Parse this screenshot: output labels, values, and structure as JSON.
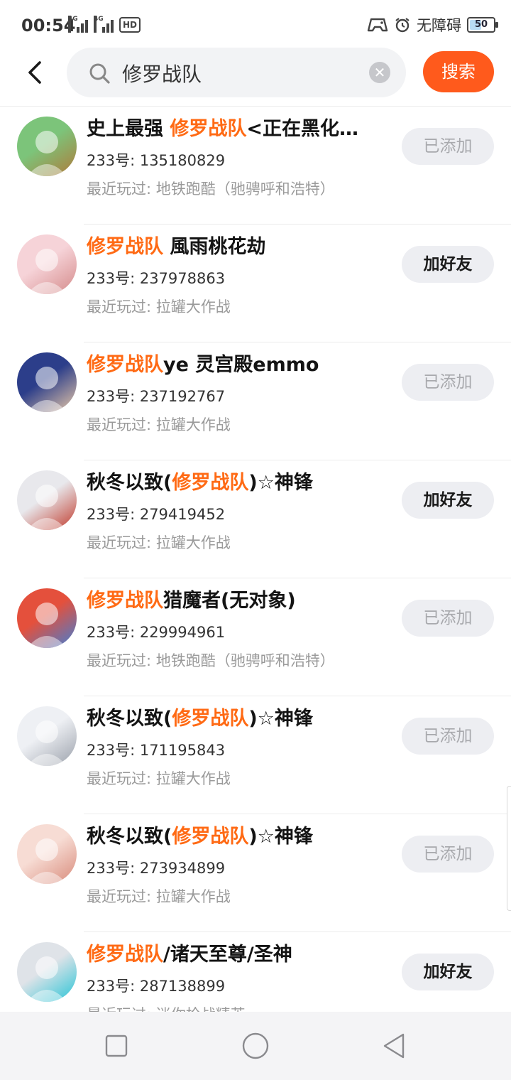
{
  "status_bar": {
    "time": "00:54",
    "network_labels": [
      "4G",
      "4G"
    ],
    "hd_label": "HD",
    "accessibility_label": "无障碍",
    "battery_level": "50",
    "icons": [
      "signal-icon",
      "signal-icon",
      "hd-icon",
      "gamepad-icon",
      "alarm-icon",
      "battery-icon"
    ]
  },
  "search": {
    "query": "修罗战队",
    "button_label": "搜索",
    "icons": [
      "back-arrow-icon",
      "search-icon",
      "clear-icon"
    ]
  },
  "results": [
    {
      "name_parts": [
        {
          "text": "史上最强 ",
          "hl": false
        },
        {
          "text": "修罗战队",
          "hl": true
        },
        {
          "text": "<正在黑化…",
          "hl": false
        }
      ],
      "uid": "233号: 135180829",
      "recent": "最近玩过: 地铁跑酷（驰骋呼和浩特）",
      "action": "已添加",
      "added": true,
      "avatar": "avatar-bear-watermelon",
      "colors": [
        "#7cc47a",
        "#b07a3a"
      ]
    },
    {
      "name_parts": [
        {
          "text": "修罗战队",
          "hl": true
        },
        {
          "text": " 風雨桃花劫",
          "hl": false
        }
      ],
      "uid": "233号: 237978863",
      "recent": "最近玩过: 拉罐大作战",
      "action": "加好友",
      "added": false,
      "avatar": "avatar-anime-girl",
      "colors": [
        "#f6d3d8",
        "#d48a8a"
      ]
    },
    {
      "name_parts": [
        {
          "text": "修罗战队",
          "hl": true
        },
        {
          "text": "ye  灵宫殿emmo",
          "hl": false
        }
      ],
      "uid": "233号: 237192767",
      "recent": "最近玩过: 拉罐大作战",
      "action": "已添加",
      "added": true,
      "avatar": "avatar-anime-detective",
      "colors": [
        "#2c3e8a",
        "#e9c9a8"
      ]
    },
    {
      "name_parts": [
        {
          "text": "秋冬以致(",
          "hl": false
        },
        {
          "text": "修罗战队",
          "hl": true
        },
        {
          "text": ")☆神锋",
          "hl": false
        }
      ],
      "uid": "233号: 279419452",
      "recent": "最近玩过: 拉罐大作战",
      "action": "加好友",
      "added": false,
      "avatar": "avatar-anime-boy-redwhite",
      "colors": [
        "#e8e8ec",
        "#c0392b"
      ]
    },
    {
      "name_parts": [
        {
          "text": "修罗战队",
          "hl": true
        },
        {
          "text": "猎魔者(无对象)",
          "hl": false
        }
      ],
      "uid": "233号: 229994961",
      "recent": "最近玩过: 地铁跑酷（驰骋呼和浩特）",
      "action": "已添加",
      "added": true,
      "avatar": "avatar-photo-boy",
      "colors": [
        "#e4503c",
        "#3f7fd6"
      ]
    },
    {
      "name_parts": [
        {
          "text": "秋冬以致(",
          "hl": false
        },
        {
          "text": "修罗战队",
          "hl": true
        },
        {
          "text": ")☆神锋",
          "hl": false
        }
      ],
      "uid": "233号: 171195843",
      "recent": "最近玩过: 拉罐大作战",
      "action": "已添加",
      "added": true,
      "avatar": "avatar-anime-boy-silver",
      "colors": [
        "#eef0f4",
        "#9aa0aa"
      ]
    },
    {
      "name_parts": [
        {
          "text": "秋冬以致(",
          "hl": false
        },
        {
          "text": "修罗战队",
          "hl": true
        },
        {
          "text": ")☆神锋",
          "hl": false
        }
      ],
      "uid": "233号: 273934899",
      "recent": "最近玩过: 拉罐大作战",
      "action": "已添加",
      "added": true,
      "avatar": "avatar-anime-boy-pink",
      "colors": [
        "#f7dcd4",
        "#d88a7a"
      ]
    },
    {
      "name_parts": [
        {
          "text": "修罗战队",
          "hl": true
        },
        {
          "text": "/诸天至尊/圣神",
          "hl": false
        }
      ],
      "uid": "233号: 287138899",
      "recent": "最近玩过: 迷你枪战精英",
      "action": "加好友",
      "added": false,
      "avatar": "avatar-chibi-cyan",
      "colors": [
        "#dfe3e8",
        "#27c4d6"
      ]
    }
  ],
  "nav_bar": {
    "icons": [
      "recent-apps-icon",
      "home-icon",
      "back-icon"
    ]
  }
}
